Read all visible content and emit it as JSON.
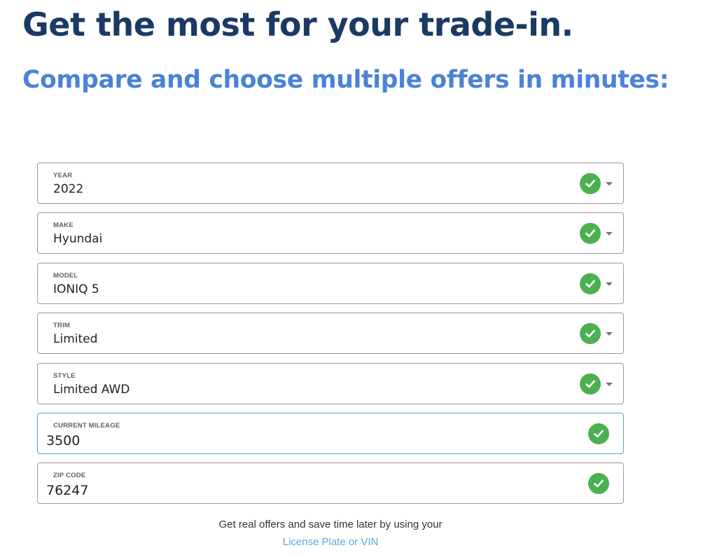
{
  "header": {
    "title": "Get the most for your trade-in.",
    "subtitle": "Compare and choose multiple offers in minutes:"
  },
  "form": {
    "fields": [
      {
        "label": "YEAR",
        "value": "2022",
        "type": "select",
        "status_icon": "check-circle-icon"
      },
      {
        "label": "MAKE",
        "value": "Hyundai",
        "type": "select",
        "status_icon": "check-circle-icon"
      },
      {
        "label": "MODEL",
        "value": "IONIQ 5",
        "type": "select",
        "status_icon": "check-circle-icon"
      },
      {
        "label": "TRIM",
        "value": "Limited",
        "type": "select",
        "status_icon": "check-circle-icon"
      },
      {
        "label": "STYLE",
        "value": "Limited AWD",
        "type": "select",
        "status_icon": "check-circle-icon"
      },
      {
        "label": "CURRENT MILEAGE",
        "value": "3500",
        "type": "input",
        "focused": true,
        "status_icon": "check-circle-icon"
      },
      {
        "label": "ZIP CODE",
        "value": "76247",
        "type": "input",
        "status_icon": "check-circle-icon"
      }
    ]
  },
  "footer": {
    "text": "Get real offers and save time later by using your",
    "link": "License Plate or VIN"
  },
  "colors": {
    "title": "#1b3a63",
    "subtitle": "#4a83d6",
    "check": "#4cb050",
    "focus_border": "#4aa6d8",
    "link": "#5aa8d8"
  }
}
